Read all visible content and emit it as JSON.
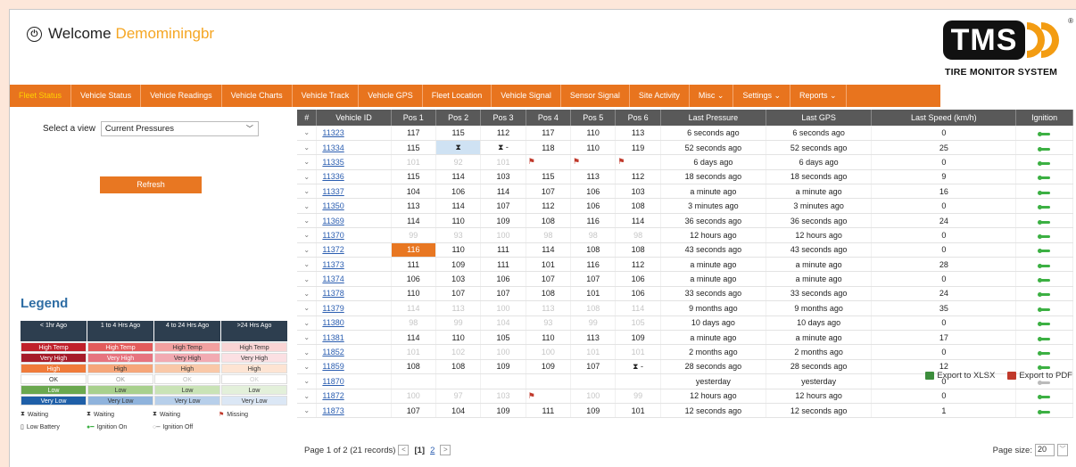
{
  "header": {
    "welcome": "Welcome",
    "username": "Demominingbr",
    "logo_text": "TMS",
    "logo_tagline": "TIRE MONITOR SYSTEM",
    "logo_reg": "®"
  },
  "nav": {
    "items": [
      {
        "label": "Fleet Status",
        "active": true
      },
      {
        "label": "Vehicle Status"
      },
      {
        "label": "Vehicle Readings"
      },
      {
        "label": "Vehicle Charts"
      },
      {
        "label": "Vehicle Track"
      },
      {
        "label": "Vehicle GPS"
      },
      {
        "label": "Fleet Location"
      },
      {
        "label": "Vehicle Signal"
      },
      {
        "label": "Sensor Signal"
      },
      {
        "label": "Site Activity"
      },
      {
        "label": "Misc ⌄"
      },
      {
        "label": "Settings ⌄"
      },
      {
        "label": "Reports ⌄"
      }
    ]
  },
  "sidebar": {
    "select_label": "Select a view",
    "select_value": "Current Pressures",
    "refresh_label": "Refresh",
    "legend_title": "Legend",
    "legend_headers": [
      "< 1hr Ago",
      "1 to 4 Hrs Ago",
      "4 to 24 Hrs Ago",
      ">24 Hrs Ago"
    ],
    "legend_rows": [
      {
        "label": "High Temp",
        "colors": [
          "#c0202a",
          "#e35b5b",
          "#f2a0a0",
          "#f9d4d4"
        ],
        "text": [
          "#fff",
          "#fff",
          "#333",
          "#333"
        ]
      },
      {
        "label": "Very High",
        "colors": [
          "#a61c2a",
          "#e7747f",
          "#f2aab2",
          "#fbe0e3"
        ],
        "text": [
          "#fff",
          "#fff",
          "#333",
          "#333"
        ]
      },
      {
        "label": "High",
        "colors": [
          "#f07b3a",
          "#f6a67a",
          "#f9c8a8",
          "#fde4d3"
        ],
        "text": [
          "#fff",
          "#333",
          "#333",
          "#333"
        ]
      },
      {
        "label": "OK",
        "colors": [
          "#ffffff",
          "#ffffff",
          "#ffffff",
          "#ffffff"
        ],
        "text": [
          "#333",
          "#999",
          "#bbb",
          "#ccc"
        ]
      },
      {
        "label": "Low",
        "colors": [
          "#6aa84f",
          "#a8d08d",
          "#c9e3b6",
          "#e3f0da"
        ],
        "text": [
          "#fff",
          "#333",
          "#333",
          "#333"
        ]
      },
      {
        "label": "Very Low",
        "colors": [
          "#1f5fa8",
          "#8fb3dc",
          "#b7cfea",
          "#dbe7f5"
        ],
        "text": [
          "#fff",
          "#333",
          "#333",
          "#333"
        ]
      }
    ],
    "legend_icons": [
      {
        "icon": "waiting-icon",
        "glyph": "⧗",
        "label": "Waiting"
      },
      {
        "icon": "waiting-icon",
        "glyph": "⧗",
        "label": "Waiting"
      },
      {
        "icon": "waiting-icon",
        "glyph": "⧗",
        "label": "Waiting"
      },
      {
        "icon": "missing-flag-icon",
        "glyph": "⚑",
        "label": "Missing"
      },
      {
        "icon": "battery-icon",
        "glyph": "▯",
        "label": "Low Battery"
      },
      {
        "icon": "ignition-on-icon",
        "glyph": "●━",
        "label": "Ignition On"
      },
      {
        "icon": "ignition-off-icon",
        "glyph": "○━",
        "label": "Ignition Off"
      }
    ]
  },
  "table": {
    "headers": [
      "#",
      "Vehicle ID",
      "Pos 1",
      "Pos 2",
      "Pos 3",
      "Pos 4",
      "Pos 5",
      "Pos 6",
      "Last Pressure",
      "Last GPS",
      "Last Speed (km/h)",
      "Ignition"
    ],
    "rows": [
      {
        "id": "11323",
        "p": [
          "117",
          "115",
          "112",
          "117",
          "110",
          "113"
        ],
        "lp": "6 seconds ago",
        "lg": "6 seconds ago",
        "sp": "0",
        "ign": true
      },
      {
        "id": "11334",
        "p": [
          "115",
          "⧗",
          "⧗ -",
          "118",
          "110",
          "119"
        ],
        "lp": "52 seconds ago",
        "lg": "52 seconds ago",
        "sp": "25",
        "ign": true,
        "sel": [
          1
        ]
      },
      {
        "id": "11335",
        "p": [
          "101",
          "92",
          "101",
          "⚑",
          "⚑",
          "⚑"
        ],
        "lp": "6 days ago",
        "lg": "6 days ago",
        "sp": "0",
        "ign": true,
        "faded": true
      },
      {
        "id": "11336",
        "p": [
          "115",
          "114",
          "103",
          "115",
          "113",
          "112"
        ],
        "lp": "18 seconds ago",
        "lg": "18 seconds ago",
        "sp": "9",
        "ign": true
      },
      {
        "id": "11337",
        "p": [
          "104",
          "106",
          "114",
          "107",
          "106",
          "103"
        ],
        "lp": "a minute ago",
        "lg": "a minute ago",
        "sp": "16",
        "ign": true
      },
      {
        "id": "11350",
        "p": [
          "113",
          "114",
          "107",
          "112",
          "106",
          "108"
        ],
        "lp": "3 minutes ago",
        "lg": "3 minutes ago",
        "sp": "0",
        "ign": true
      },
      {
        "id": "11369",
        "p": [
          "114",
          "110",
          "109",
          "108",
          "116",
          "114"
        ],
        "lp": "36 seconds ago",
        "lg": "36 seconds ago",
        "sp": "24",
        "ign": true
      },
      {
        "id": "11370",
        "p": [
          "99",
          "93",
          "100",
          "98",
          "98",
          "98"
        ],
        "lp": "12 hours ago",
        "lg": "12 hours ago",
        "sp": "0",
        "ign": true,
        "faded": true
      },
      {
        "id": "11372",
        "p": [
          "116",
          "110",
          "111",
          "114",
          "108",
          "108"
        ],
        "lp": "43 seconds ago",
        "lg": "43 seconds ago",
        "sp": "0",
        "ign": true,
        "hl": [
          0
        ]
      },
      {
        "id": "11373",
        "p": [
          "111",
          "109",
          "111",
          "101",
          "116",
          "112"
        ],
        "lp": "a minute ago",
        "lg": "a minute ago",
        "sp": "28",
        "ign": true
      },
      {
        "id": "11374",
        "p": [
          "106",
          "103",
          "106",
          "107",
          "107",
          "106"
        ],
        "lp": "a minute ago",
        "lg": "a minute ago",
        "sp": "0",
        "ign": true
      },
      {
        "id": "11378",
        "p": [
          "110",
          "107",
          "107",
          "108",
          "101",
          "106"
        ],
        "lp": "33 seconds ago",
        "lg": "33 seconds ago",
        "sp": "24",
        "ign": true
      },
      {
        "id": "11379",
        "p": [
          "114",
          "113",
          "100",
          "113",
          "108",
          "114"
        ],
        "lp": "9 months ago",
        "lg": "9 months ago",
        "sp": "35",
        "ign": true,
        "faded": true
      },
      {
        "id": "11380",
        "p": [
          "98",
          "99",
          "104",
          "93",
          "99",
          "105"
        ],
        "lp": "10 days ago",
        "lg": "10 days ago",
        "sp": "0",
        "ign": true,
        "faded": true
      },
      {
        "id": "11381",
        "p": [
          "114",
          "110",
          "105",
          "110",
          "113",
          "109"
        ],
        "lp": "a minute ago",
        "lg": "a minute ago",
        "sp": "17",
        "ign": true
      },
      {
        "id": "11852",
        "p": [
          "101",
          "102",
          "100",
          "100",
          "101",
          "101"
        ],
        "lp": "2 months ago",
        "lg": "2 months ago",
        "sp": "0",
        "ign": true,
        "faded": true
      },
      {
        "id": "11859",
        "p": [
          "108",
          "108",
          "109",
          "109",
          "107",
          "⧗ -"
        ],
        "lp": "28 seconds ago",
        "lg": "28 seconds ago",
        "sp": "12",
        "ign": true
      },
      {
        "id": "11870",
        "p": [
          "",
          "",
          "",
          "",
          "",
          ""
        ],
        "lp": "yesterday",
        "lg": "yesterday",
        "sp": "0",
        "ign": false
      },
      {
        "id": "11872",
        "p": [
          "100",
          "97",
          "103",
          "⚑",
          "100",
          "99"
        ],
        "lp": "12 hours ago",
        "lg": "12 hours ago",
        "sp": "0",
        "ign": true,
        "faded": true
      },
      {
        "id": "11873",
        "p": [
          "107",
          "104",
          "109",
          "111",
          "109",
          "101"
        ],
        "lp": "12 seconds ago",
        "lg": "12 seconds ago",
        "sp": "1",
        "ign": true
      }
    ]
  },
  "pager": {
    "summary": "Page 1 of 2 (21 records)",
    "prev": "<",
    "current": "[1]",
    "next_page": "2",
    "next": ">",
    "page_size_label": "Page size:",
    "page_size": "20"
  },
  "exports": {
    "xlsx": "Export to XLSX",
    "pdf": "Export to PDF"
  }
}
